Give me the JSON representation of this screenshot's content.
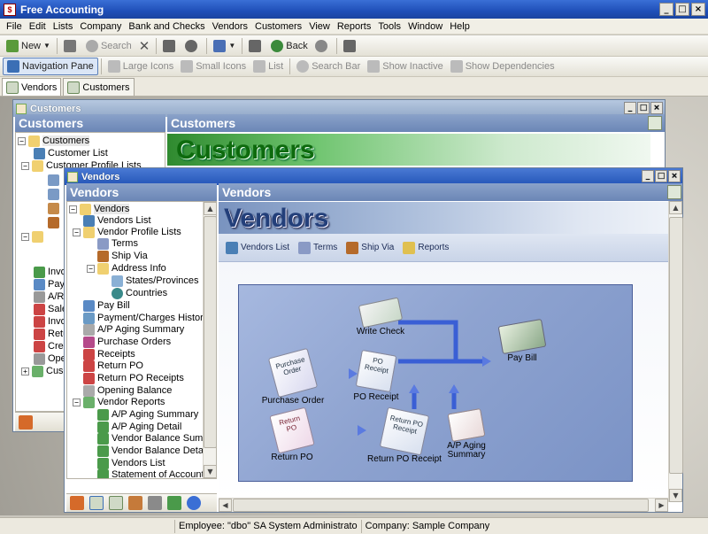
{
  "app": {
    "title": "Free Accounting",
    "window_buttons": [
      "_",
      "□",
      "×"
    ]
  },
  "menu": [
    "File",
    "Edit",
    "Lists",
    "Company",
    "Bank and Checks",
    "Vendors",
    "Customers",
    "View",
    "Reports",
    "Tools",
    "Window",
    "Help"
  ],
  "toolbar1": {
    "new": "New",
    "search": "Search",
    "back": "Back"
  },
  "toolbar2": {
    "navigation_pane": "Navigation Pane",
    "large_icons": "Large Icons",
    "small_icons": "Small Icons",
    "list": "List",
    "search_bar": "Search Bar",
    "show_inactive": "Show Inactive",
    "show_dependencies": "Show Dependencies"
  },
  "tabs": [
    "Vendors",
    "Customers"
  ],
  "customers_window": {
    "title": "Customers",
    "pane_header": "Customers",
    "content_header": "Customers",
    "banner": "Customers",
    "tree": [
      "Customers",
      "Customer List",
      "Customer Profile Lists",
      "Invo",
      "Pay",
      "A/R",
      "Sale",
      "Invo",
      "Retu",
      "Cred",
      "Ope",
      "Cus"
    ]
  },
  "vendors_window": {
    "title": "Vendors",
    "pane_header": "Vendors",
    "content_header": "Vendors",
    "banner": "Vendors",
    "tree": [
      "Vendors",
      "Vendors List",
      "Vendor Profile Lists",
      "Terms",
      "Ship Via",
      "Address Info",
      "States/Provinces",
      "Countries",
      "Pay Bill",
      "Payment/Charges History",
      "A/P Aging Summary",
      "Purchase Orders",
      "Receipts",
      "Return PO",
      "Return PO Receipts",
      "Opening Balance",
      "Vendor Reports",
      "A/P Aging Summary",
      "A/P Aging Detail",
      "Vendor Balance Summary",
      "Vendor Balance Detail",
      "Vendors List",
      "Statement of Account For"
    ],
    "shortcuts": [
      "Vendors List",
      "Terms",
      "Ship Via",
      "Reports"
    ],
    "flow": {
      "write_check": "Write Check",
      "pay_bill": "Pay Bill",
      "purchase_order": "Purchase Order",
      "po_receipt": "PO Receipt",
      "return_po": "Return PO",
      "return_po_receipt": "Return PO Receipt",
      "ap_aging_summary": "A/P Aging\nSummary",
      "doc_purchase_order": "Purchase\nOrder",
      "doc_po_receipt": "PO\nReceipt",
      "doc_return_po": "Return\nPO",
      "doc_return_po_receipt": "Return PO\nReceipt"
    }
  },
  "status": {
    "employee": "Employee: \"dbo\" SA System Administrato",
    "company": "Company: Sample Company"
  }
}
